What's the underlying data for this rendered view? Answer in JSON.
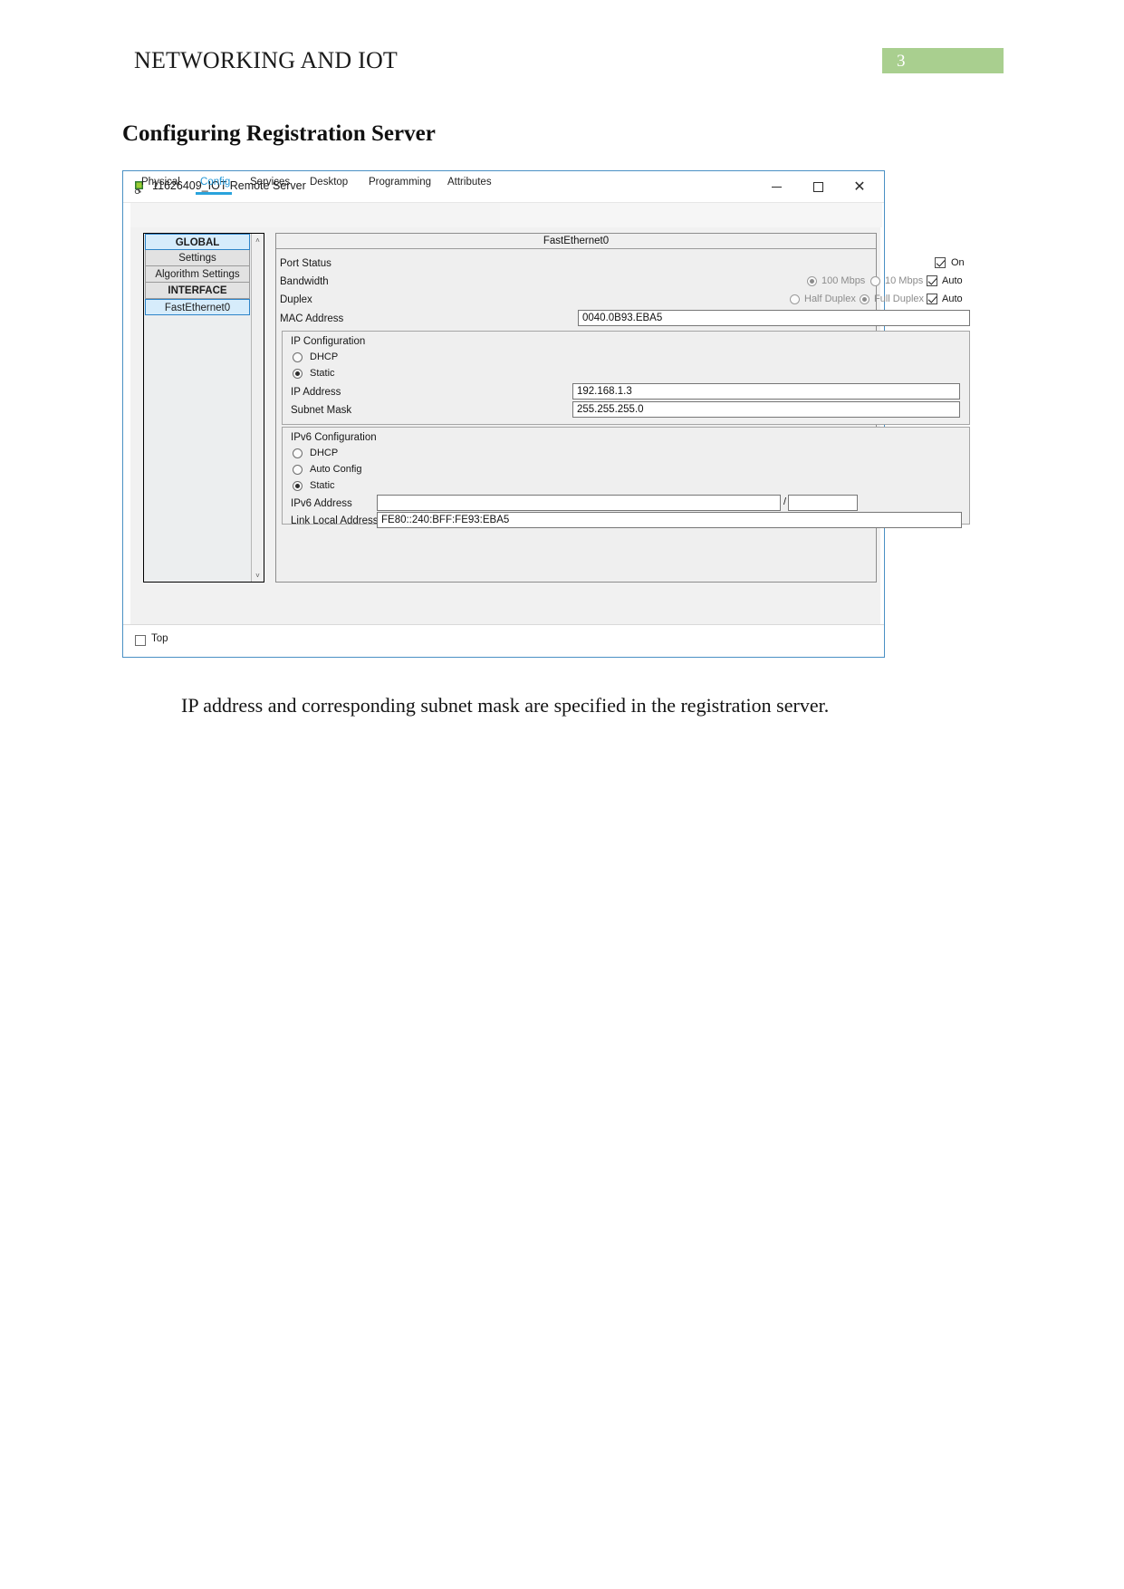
{
  "document": {
    "running_head": "NETWORKING AND IOT",
    "page_number": "3",
    "section_heading": "Configuring Registration Server",
    "caption": "IP address and corresponding subnet mask are specified in the registration server."
  },
  "window": {
    "title": "11626409_IOT Remote Server",
    "icon": "packet-tracer-device-icon",
    "minimize_label": "─",
    "maximize_label": "□",
    "close_label": "✕"
  },
  "tabs": [
    {
      "label": "Physical",
      "active": false
    },
    {
      "label": "Config",
      "active": true
    },
    {
      "label": "Services",
      "active": false
    },
    {
      "label": "Desktop",
      "active": false
    },
    {
      "label": "Programming",
      "active": false
    },
    {
      "label": "Attributes",
      "active": false
    }
  ],
  "sidebar": {
    "items": [
      {
        "label": "GLOBAL",
        "type": "header",
        "selected": true
      },
      {
        "label": "Settings",
        "type": "item",
        "selected": false
      },
      {
        "label": "Algorithm Settings",
        "type": "item",
        "selected": false
      },
      {
        "label": "INTERFACE",
        "type": "header",
        "selected": false
      },
      {
        "label": "FastEthernet0",
        "type": "item",
        "selected": true
      }
    ],
    "scroll_up_glyph": "˄",
    "scroll_down_glyph": "˅"
  },
  "config": {
    "panel_title": "FastEthernet0",
    "port_status": {
      "label": "Port Status",
      "on_label": "On",
      "on_checked": true
    },
    "bandwidth": {
      "label": "Bandwidth",
      "option_100": "100 Mbps",
      "option_10": "10 Mbps",
      "selected": "100 Mbps",
      "auto_label": "Auto",
      "auto_checked": true
    },
    "duplex": {
      "label": "Duplex",
      "option_half": "Half Duplex",
      "option_full": "Full Duplex",
      "selected": "Full Duplex",
      "auto_label": "Auto",
      "auto_checked": true
    },
    "mac_address": {
      "label": "MAC Address",
      "value": "0040.0B93.EBA5"
    },
    "ip_configuration": {
      "title": "IP Configuration",
      "dhcp_label": "DHCP",
      "static_label": "Static",
      "selected": "Static",
      "ip_address_label": "IP Address",
      "ip_address_value": "192.168.1.3",
      "subnet_mask_label": "Subnet Mask",
      "subnet_mask_value": "255.255.255.0"
    },
    "ipv6_configuration": {
      "title": "IPv6 Configuration",
      "dhcp_label": "DHCP",
      "auto_config_label": "Auto Config",
      "static_label": "Static",
      "selected": "Static",
      "ipv6_address_label": "IPv6 Address",
      "ipv6_address_value": "",
      "ipv6_prefix_value": "",
      "ipv6_separator": "/",
      "link_local_label": "Link Local Address:",
      "link_local_value": "FE80::240:BFF:FE93:EBA5"
    }
  },
  "bottom": {
    "top_label": "Top",
    "top_checked": false
  }
}
